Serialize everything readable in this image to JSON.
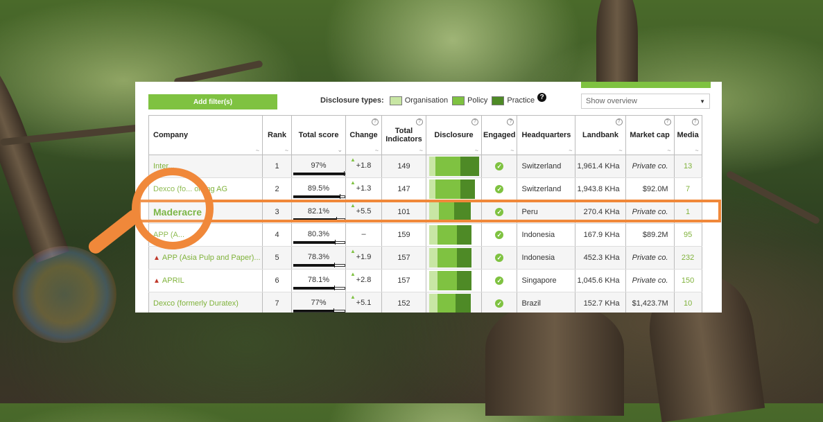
{
  "toolbar": {
    "add_filter_label": "Add filter(s)",
    "help_symbol": "?"
  },
  "disclosure_legend": {
    "label": "Disclosure types:",
    "items": [
      {
        "name": "Organisation",
        "color": "#c8e6a4"
      },
      {
        "name": "Policy",
        "color": "#7fc241"
      },
      {
        "name": "Practice",
        "color": "#4e8a26"
      }
    ]
  },
  "view_select": {
    "selected": "Show overview"
  },
  "columns": [
    "Company",
    "Rank",
    "Total score",
    "Change",
    "Total Indicators",
    "Disclosure",
    "Engaged",
    "Headquarters",
    "Landbank",
    "Market cap",
    "Media"
  ],
  "rows": [
    {
      "company": "Inter...",
      "rank": "1",
      "score": "97%",
      "score_pct": 97,
      "change": "+1.8",
      "up": true,
      "indicators": "149",
      "disc": [
        0.13,
        0.62,
        1.0
      ],
      "hq": "Switzerland",
      "landbank": "1,961.4 KHa",
      "mcap": "Private co.",
      "mcap_private": true,
      "media": "13"
    },
    {
      "company": "Dexco (fo... olding AG",
      "rank": "2",
      "score": "89.5%",
      "score_pct": 89.5,
      "change": "+1.3",
      "up": true,
      "indicators": "147",
      "disc": [
        0.13,
        0.62,
        0.92
      ],
      "hq": "Switzerland",
      "landbank": "1,943.8 KHa",
      "mcap": "$92.0M",
      "mcap_private": false,
      "media": "7"
    },
    {
      "company": "Maderacre",
      "rank": "3",
      "score": "82.1%",
      "score_pct": 82.1,
      "change": "+5.5",
      "up": true,
      "indicators": "101",
      "disc": [
        0.2,
        0.5,
        0.83
      ],
      "hq": "Peru",
      "landbank": "270.4 KHa",
      "mcap": "Private co.",
      "mcap_private": true,
      "media": "1"
    },
    {
      "company": "APP (A...",
      "rank": "4",
      "score": "80.3%",
      "score_pct": 80.3,
      "change": "–",
      "up": false,
      "indicators": "159",
      "disc": [
        0.16,
        0.55,
        0.85
      ],
      "hq": "Indonesia",
      "landbank": "167.9 KHa",
      "mcap": "$89.2M",
      "mcap_private": false,
      "media": "95"
    },
    {
      "company": "APP (Asia Pulp and Paper)...",
      "rank": "5",
      "score": "78.3%",
      "score_pct": 78.3,
      "change": "+1.9",
      "up": true,
      "indicators": "157",
      "disc": [
        0.16,
        0.55,
        0.85
      ],
      "hq": "Indonesia",
      "landbank": "452.3 KHa",
      "mcap": "Private co.",
      "mcap_private": true,
      "media": "232"
    },
    {
      "company": "APRIL",
      "rank": "6",
      "score": "78.1%",
      "score_pct": 78.1,
      "change": "+2.8",
      "up": true,
      "indicators": "157",
      "disc": [
        0.16,
        0.55,
        0.85
      ],
      "hq": "Singapore",
      "landbank": "1,045.6 KHa",
      "mcap": "Private co.",
      "mcap_private": true,
      "media": "150"
    },
    {
      "company": "Dexco (formerly Duratex)",
      "rank": "7",
      "score": "77%",
      "score_pct": 77,
      "change": "+5.1",
      "up": true,
      "indicators": "152",
      "disc": [
        0.16,
        0.53,
        0.83
      ],
      "hq": "Brazil",
      "landbank": "152.7 KHa",
      "mcap": "$1,423.7M",
      "mcap_private": false,
      "media": "10"
    }
  ]
}
